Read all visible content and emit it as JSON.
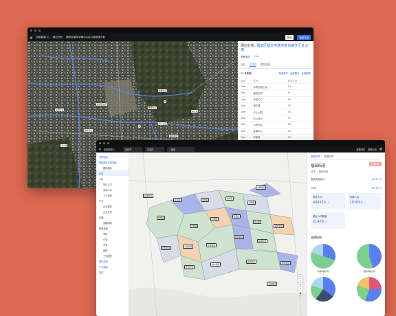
{
  "window1": {
    "brand": "四维智能·公",
    "nav": [
      "周边分析",
      "福田区福华中路中心区公路全体分析"
    ],
    "btn_white": "登录",
    "btn_blue": "免费试用",
    "panel": {
      "title_prefix": "周边分析:",
      "title_main": "福田区福华中路市金信路交汇处北角",
      "radius_label": "查看半径",
      "radius_value": "1km",
      "tabs": [
        "社区",
        "工作日",
        "居住设施"
      ],
      "list_header": "20 条数据",
      "actions": [
        "筛选条件",
        "全部展开",
        "全部删除"
      ],
      "columns": [
        "距离",
        "名称",
        "数量分值"
      ],
      "rows": [
        [
          "1km",
          "市规划国土局",
          "42"
        ],
        [
          "1km",
          "福田区府",
          "41"
        ],
        [
          "1km",
          "市民中心",
          "40"
        ],
        [
          "1km",
          "福华路",
          "39"
        ],
        [
          "1km",
          "中心公园",
          "38"
        ],
        [
          "1km",
          "中心商业",
          "37"
        ],
        [
          "1km",
          "中观光区",
          "36"
        ],
        [
          "1km",
          "金融中心",
          "35"
        ],
        [
          "1km",
          "市政府",
          "34"
        ]
      ]
    },
    "map_labels": [
      "福田区政府",
      "市民中心",
      "会展中心",
      "中心公园",
      "金融中心区",
      "福华新村",
      "深南大道",
      "岗厦北站",
      "莲花山公园",
      "上沙村",
      "下沙村",
      "车公庙"
    ]
  },
  "window2": {
    "brand": "四维数据公",
    "selects": [
      "深圳市",
      "请选择"
    ],
    "search_placeholder": "搜索",
    "top_right": [
      "数据列表",
      "数据分析"
    ],
    "sidebar": [
      {
        "label": "市场检测",
        "type": "hd"
      },
      {
        "label": "数据服务市场地图",
        "type": "hd"
      },
      {
        "label": "基础指标",
        "type": "sub"
      },
      {
        "label": "总览",
        "type": "act"
      },
      {
        "label": "人口",
        "type": "grp"
      },
      {
        "label": "常住人口",
        "type": "sub"
      },
      {
        "label": "流动人口",
        "type": "sub"
      },
      {
        "label": "人口年龄",
        "type": "sub"
      },
      {
        "label": "产业",
        "type": "grp"
      },
      {
        "label": "企业数量",
        "type": "sub"
      },
      {
        "label": "企业分布",
        "type": "sub"
      },
      {
        "label": "交通",
        "type": "grp"
      },
      {
        "label": "道路网络",
        "type": "sub"
      },
      {
        "label": "配套设施",
        "type": "grp"
      },
      {
        "label": "学校",
        "type": "sub"
      },
      {
        "label": "小学",
        "type": "sub"
      },
      {
        "label": "中学",
        "type": "sub"
      },
      {
        "label": "医院",
        "type": "sub"
      },
      {
        "label": "三甲医院",
        "type": "sub"
      },
      {
        "label": "城市规划",
        "type": "hd"
      },
      {
        "label": "产业链路",
        "type": "hd"
      },
      {
        "label": "招商",
        "type": "hd"
      }
    ],
    "panel": {
      "tabs": [
        "数据详情",
        "数据列表"
      ],
      "title": "福田街道",
      "badge": "数据报告",
      "subtabs": [
        "总览",
        "基础信息"
      ],
      "score_label": "板块综合评分",
      "score_value": "84.71 分",
      "pop_label": "人口",
      "pop_value": "89.40 分",
      "cards": [
        {
          "label": "常驻人口",
          "value": "404914",
          "unit": "人"
        },
        {
          "label": "流动人口",
          "value": "191692",
          "unit": "人"
        },
        {
          "label": "就业人口数量",
          "value": "21479",
          "unit": "人"
        }
      ],
      "section": "画像结构",
      "pie_labels": [
        "总体年龄分布",
        "居民年龄分布"
      ],
      "legend": [
        "30%",
        "50%",
        "20%"
      ]
    },
    "districts": [
      "福田区",
      "南山区",
      "罗湖区",
      "宝安区",
      "龙岗区",
      "龙华区",
      "盐田区",
      "光明区",
      "坪山区",
      "大鹏新区",
      "西乡街道",
      "新安街道",
      "沙井街道",
      "松岗街道",
      "福永街道",
      "观澜街道",
      "民治街道",
      "布吉街道",
      "横岗街道",
      "坪地街道",
      "葵涌街道",
      "南澳街道"
    ],
    "zoom": [
      "+",
      "−",
      "⟳",
      "⌖",
      "▣"
    ]
  },
  "colors": {
    "background": "#dd6a52",
    "accent": "#2f6df2",
    "map_blue": "#a9b4ea",
    "map_green": "#cfe4d0",
    "map_orange": "#f2d3b2"
  }
}
